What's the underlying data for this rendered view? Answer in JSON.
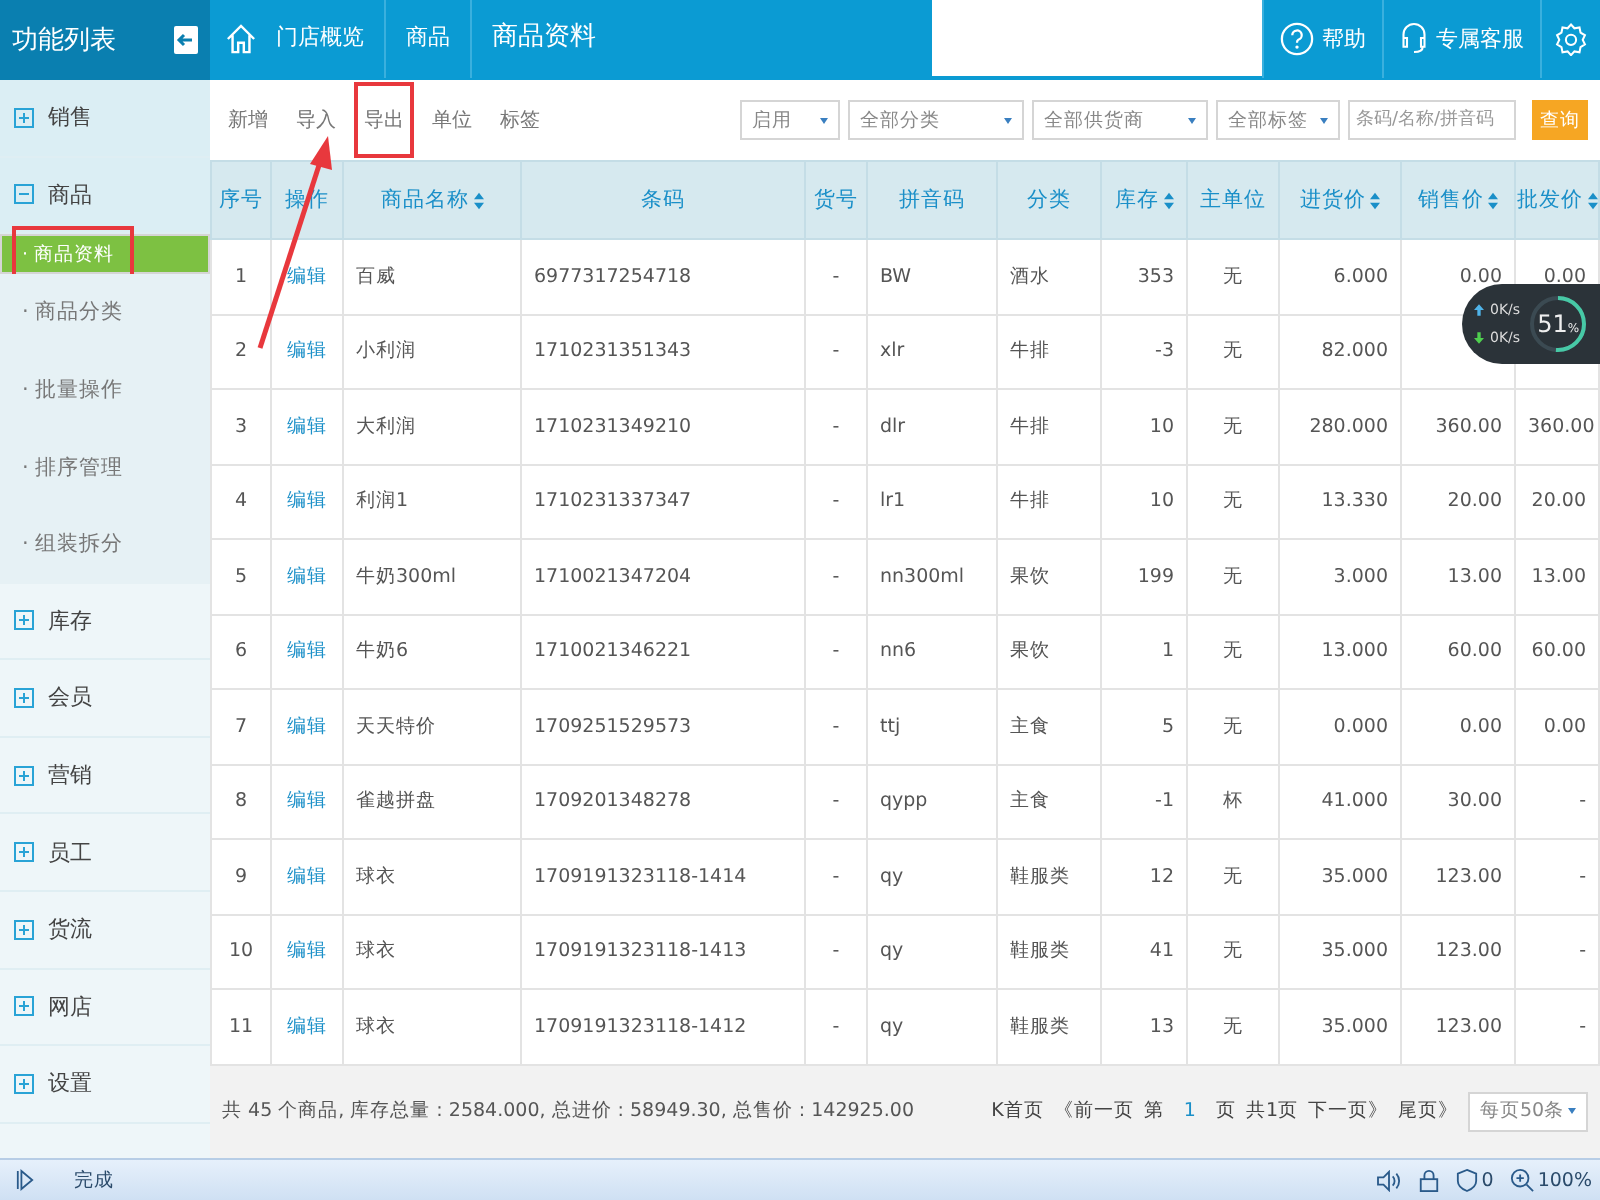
{
  "sidebar": {
    "title": "功能列表",
    "items": [
      {
        "label": "销售",
        "expanded": false
      },
      {
        "label": "商品",
        "expanded": true,
        "children": [
          {
            "label": "· 商品资料",
            "selected": true,
            "highlighted": true
          },
          {
            "label": "· 商品分类",
            "selected": false,
            "highlighted": false
          },
          {
            "label": "· 批量操作",
            "selected": false,
            "highlighted": false
          },
          {
            "label": "· 排序管理",
            "selected": false,
            "highlighted": false
          },
          {
            "label": "· 组装拆分",
            "selected": false,
            "highlighted": false
          }
        ]
      },
      {
        "label": "库存",
        "expanded": false
      },
      {
        "label": "会员",
        "expanded": false
      },
      {
        "label": "营销",
        "expanded": false
      },
      {
        "label": "员工",
        "expanded": false
      },
      {
        "label": "货流",
        "expanded": false
      },
      {
        "label": "网店",
        "expanded": false
      },
      {
        "label": "设置",
        "expanded": false
      }
    ]
  },
  "breadcrumb": [
    "门店概览",
    "商品",
    "商品资料"
  ],
  "header_actions": [
    "帮助",
    "专属客服"
  ],
  "toolbar": {
    "actions": [
      {
        "label": "新增",
        "highlighted": false
      },
      {
        "label": "导入",
        "highlighted": false
      },
      {
        "label": "导出",
        "highlighted": true
      },
      {
        "label": "单位",
        "highlighted": false
      },
      {
        "label": "标签",
        "highlighted": false
      }
    ],
    "filters": [
      {
        "value": "启用"
      },
      {
        "value": "全部分类"
      },
      {
        "value": "全部供货商"
      },
      {
        "value": "全部标签"
      }
    ],
    "search": {
      "placeholder": "条码/名称/拼音码"
    },
    "query_button": "查询"
  },
  "table": {
    "columns": [
      {
        "label": "序号",
        "kind": "center",
        "sortable": false
      },
      {
        "label": "操作",
        "kind": "link",
        "sortable": false
      },
      {
        "label": "商品名称",
        "kind": "text",
        "sortable": true
      },
      {
        "label": "条码",
        "kind": "text",
        "sortable": false
      },
      {
        "label": "货号",
        "kind": "center",
        "sortable": false
      },
      {
        "label": "拼音码",
        "kind": "text",
        "sortable": false
      },
      {
        "label": "分类",
        "kind": "text",
        "sortable": false
      },
      {
        "label": "库存",
        "kind": "number",
        "sortable": true
      },
      {
        "label": "主单位",
        "kind": "center",
        "sortable": false
      },
      {
        "label": "进货价",
        "kind": "number",
        "sortable": true
      },
      {
        "label": "销售价",
        "kind": "number",
        "sortable": true
      },
      {
        "label": "批发价",
        "kind": "number",
        "sortable": true
      }
    ],
    "rows": [
      {
        "cells": [
          "1",
          "编辑",
          "百威",
          "6977317254718",
          "-",
          "BW",
          "酒水",
          "353",
          "无",
          "6.000",
          "0.00",
          "0.00"
        ]
      },
      {
        "cells": [
          "2",
          "编辑",
          "小利润",
          "1710231351343",
          "-",
          "xlr",
          "牛排",
          "-3",
          "无",
          "82.000",
          null,
          null
        ]
      },
      {
        "cells": [
          "3",
          "编辑",
          "大利润",
          "1710231349210",
          "-",
          "dlr",
          "牛排",
          "10",
          "无",
          "280.000",
          "360.00",
          "360.00"
        ]
      },
      {
        "cells": [
          "4",
          "编辑",
          "利润1",
          "1710231337347",
          "-",
          "lr1",
          "牛排",
          "10",
          "无",
          "13.330",
          "20.00",
          "20.00"
        ]
      },
      {
        "cells": [
          "5",
          "编辑",
          "牛奶300ml",
          "1710021347204",
          "-",
          "nn300ml",
          "果饮",
          "199",
          "无",
          "3.000",
          "13.00",
          "13.00"
        ]
      },
      {
        "cells": [
          "6",
          "编辑",
          "牛奶6",
          "1710021346221",
          "-",
          "nn6",
          "果饮",
          "1",
          "无",
          "13.000",
          "60.00",
          "60.00"
        ]
      },
      {
        "cells": [
          "7",
          "编辑",
          "天天特价",
          "1709251529573",
          "-",
          "ttj",
          "主食",
          "5",
          "无",
          "0.000",
          "0.00",
          "0.00"
        ]
      },
      {
        "cells": [
          "8",
          "编辑",
          "雀越拼盘",
          "1709201348278",
          "-",
          "qypp",
          "主食",
          "-1",
          "杯",
          "41.000",
          "30.00",
          "-"
        ]
      },
      {
        "cells": [
          "9",
          "编辑",
          "球衣",
          "1709191323118-1414",
          "-",
          "qy",
          "鞋服类",
          "12",
          "无",
          "35.000",
          "123.00",
          "-"
        ]
      },
      {
        "cells": [
          "10",
          "编辑",
          "球衣",
          "1709191323118-1413",
          "-",
          "qy",
          "鞋服类",
          "41",
          "无",
          "35.000",
          "123.00",
          "-"
        ]
      },
      {
        "cells": [
          "11",
          "编辑",
          "球衣",
          "1709191323118-1412",
          "-",
          "qy",
          "鞋服类",
          "13",
          "无",
          "35.000",
          "123.00",
          "-"
        ]
      }
    ]
  },
  "footer": {
    "summary": "共 45 个商品, 库存总量 : 2584.000, 总进价 : 58949.30, 总售价 : 142925.00",
    "pager": {
      "first": "K首页",
      "prev": "《前一页",
      "page_prefix": "第",
      "page": "1",
      "page_suffix": "页",
      "total": "共1页",
      "next": "下一页》",
      "last": "尾页》",
      "per_page": "每页50条"
    }
  },
  "speed_widget": {
    "upload": "0K/s",
    "download": "0K/s",
    "percent": "51",
    "unit": "%",
    "level": 0.51
  },
  "status_bar": {
    "text": "完成",
    "shield_count": "0",
    "zoom": "100%"
  }
}
